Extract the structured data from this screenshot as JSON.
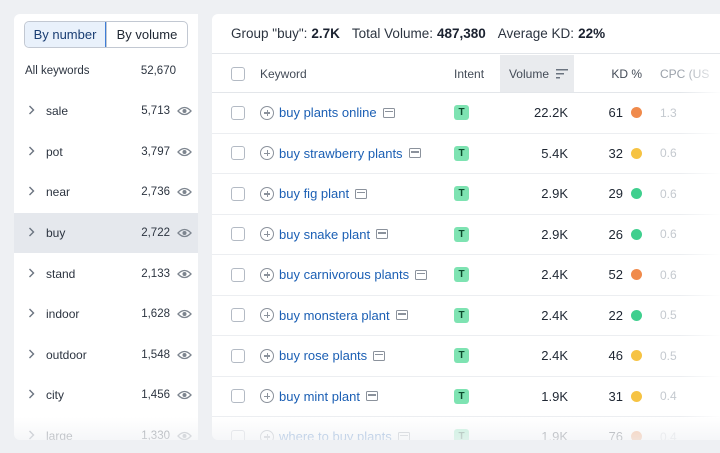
{
  "toggle": {
    "by_number": "By number",
    "by_volume": "By volume"
  },
  "all_keywords": {
    "label": "All keywords",
    "count": "52,670"
  },
  "groups": [
    {
      "name": "sale",
      "count": "5,713",
      "selected": false
    },
    {
      "name": "pot",
      "count": "3,797",
      "selected": false
    },
    {
      "name": "near",
      "count": "2,736",
      "selected": false
    },
    {
      "name": "buy",
      "count": "2,722",
      "selected": true
    },
    {
      "name": "stand",
      "count": "2,133",
      "selected": false
    },
    {
      "name": "indoor",
      "count": "1,628",
      "selected": false
    },
    {
      "name": "outdoor",
      "count": "1,548",
      "selected": false
    },
    {
      "name": "city",
      "count": "1,456",
      "selected": false
    },
    {
      "name": "large",
      "count": "1,330",
      "selected": false
    }
  ],
  "summary": {
    "group_label": "Group \"buy\":",
    "group_value": "2.7K",
    "volume_label": "Total Volume:",
    "volume_value": "487,380",
    "kd_label": "Average KD:",
    "kd_value": "22%"
  },
  "columns": {
    "keyword": "Keyword",
    "intent": "Intent",
    "volume": "Volume",
    "kd": "KD %",
    "cpc": "CPC (US"
  },
  "rows": [
    {
      "keyword": "buy plants online",
      "intent": "T",
      "volume": "22.2K",
      "kd": "61",
      "kd_color": "#f08a4b",
      "cpc": "1.3"
    },
    {
      "keyword": "buy strawberry plants",
      "intent": "T",
      "volume": "5.4K",
      "kd": "32",
      "kd_color": "#f6c343",
      "cpc": "0.6"
    },
    {
      "keyword": "buy fig plant",
      "intent": "T",
      "volume": "2.9K",
      "kd": "29",
      "kd_color": "#3fcf8e",
      "cpc": "0.6"
    },
    {
      "keyword": "buy snake plant",
      "intent": "T",
      "volume": "2.9K",
      "kd": "26",
      "kd_color": "#3fcf8e",
      "cpc": "0.6"
    },
    {
      "keyword": "buy carnivorous plants",
      "intent": "T",
      "volume": "2.4K",
      "kd": "52",
      "kd_color": "#f08a4b",
      "cpc": "0.6"
    },
    {
      "keyword": "buy monstera plant",
      "intent": "T",
      "volume": "2.4K",
      "kd": "22",
      "kd_color": "#3fcf8e",
      "cpc": "0.5"
    },
    {
      "keyword": "buy rose plants",
      "intent": "T",
      "volume": "2.4K",
      "kd": "46",
      "kd_color": "#f6c343",
      "cpc": "0.5"
    },
    {
      "keyword": "buy mint plant",
      "intent": "T",
      "volume": "1.9K",
      "kd": "31",
      "kd_color": "#f6c343",
      "cpc": "0.4"
    },
    {
      "keyword": "where to buy plants",
      "intent": "T",
      "volume": "1.9K",
      "kd": "76",
      "kd_color": "#f08a4b",
      "cpc": "0.4"
    }
  ],
  "icons": {
    "eye": "eye-icon",
    "chevron": "chevron-right-icon",
    "sort": "sort-icon",
    "add": "plus-circle-icon",
    "serp": "serp-features-icon"
  }
}
